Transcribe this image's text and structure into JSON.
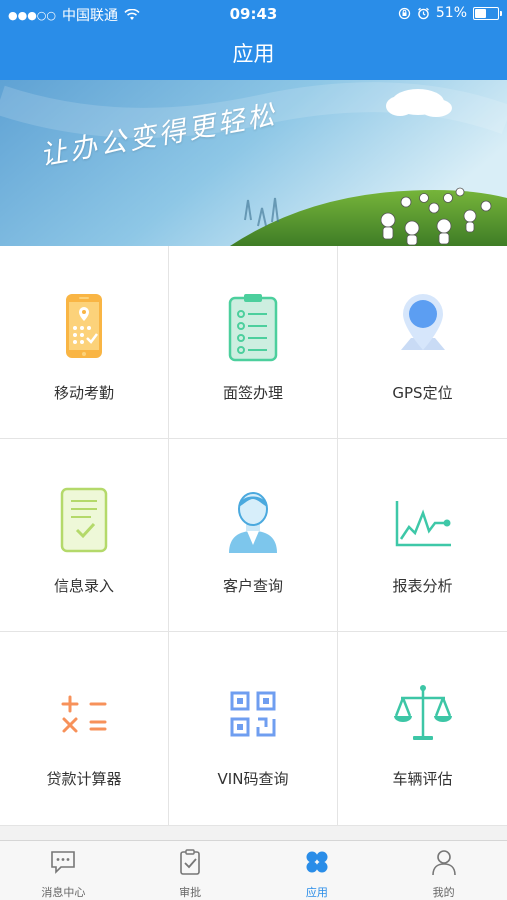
{
  "status_bar": {
    "signal": "●●●○○",
    "carrier": "中国联通",
    "time": "09:43",
    "battery_percent": "51%",
    "battery_level": 0.51
  },
  "header": {
    "title": "应用"
  },
  "banner": {
    "slogan": "让办公变得更轻松"
  },
  "apps": [
    {
      "label": "移动考勤",
      "icon": "mobile-attendance-icon"
    },
    {
      "label": "面签办理",
      "icon": "checklist-clipboard-icon"
    },
    {
      "label": "GPS定位",
      "icon": "location-pin-icon"
    },
    {
      "label": "信息录入",
      "icon": "document-check-icon"
    },
    {
      "label": "客户查询",
      "icon": "customer-person-icon"
    },
    {
      "label": "报表分析",
      "icon": "line-chart-icon"
    },
    {
      "label": "贷款计算器",
      "icon": "calculator-symbols-icon"
    },
    {
      "label": "VIN码查询",
      "icon": "qr-code-icon"
    },
    {
      "label": "车辆评估",
      "icon": "balance-scale-icon"
    }
  ],
  "tab_bar": {
    "active_color": "#2a8de8",
    "tabs": [
      {
        "label": "消息中心",
        "icon": "message-bubble-icon"
      },
      {
        "label": "审批",
        "icon": "approval-clipboard-icon"
      },
      {
        "label": "应用",
        "icon": "apps-grid-icon",
        "active": true
      },
      {
        "label": "我的",
        "icon": "user-profile-icon"
      }
    ]
  },
  "colors": {
    "brand_blue": "#2a8de8"
  }
}
